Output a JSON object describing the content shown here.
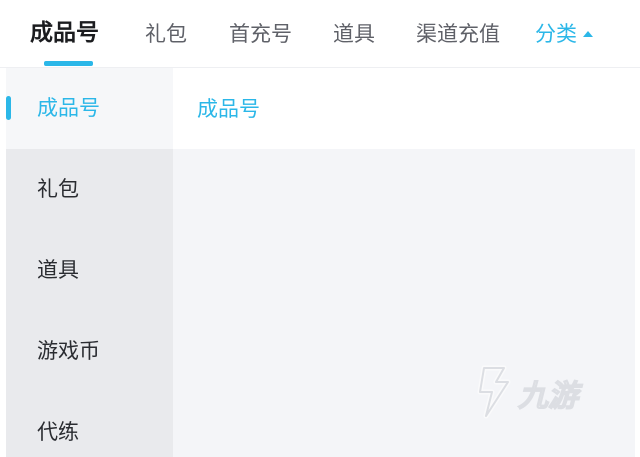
{
  "top_tabs": [
    {
      "label": "成品号",
      "active": true
    },
    {
      "label": "礼包",
      "active": false
    },
    {
      "label": "首充号",
      "active": false
    },
    {
      "label": "道具",
      "active": false
    },
    {
      "label": "渠道充值",
      "active": false
    }
  ],
  "category_toggle": {
    "label": "分类",
    "icon": "caret-up-icon"
  },
  "sidebar": {
    "items": [
      {
        "label": "成品号",
        "active": true
      },
      {
        "label": "礼包",
        "active": false
      },
      {
        "label": "道具",
        "active": false
      },
      {
        "label": "游戏币",
        "active": false
      },
      {
        "label": "代练",
        "active": false
      }
    ]
  },
  "content": {
    "title": "成品号"
  },
  "watermark": {
    "text": "九游"
  },
  "colors": {
    "accent": "#2bb7e8",
    "sidebar_bg": "#e9eaed",
    "content_bg": "#f4f5f8"
  }
}
